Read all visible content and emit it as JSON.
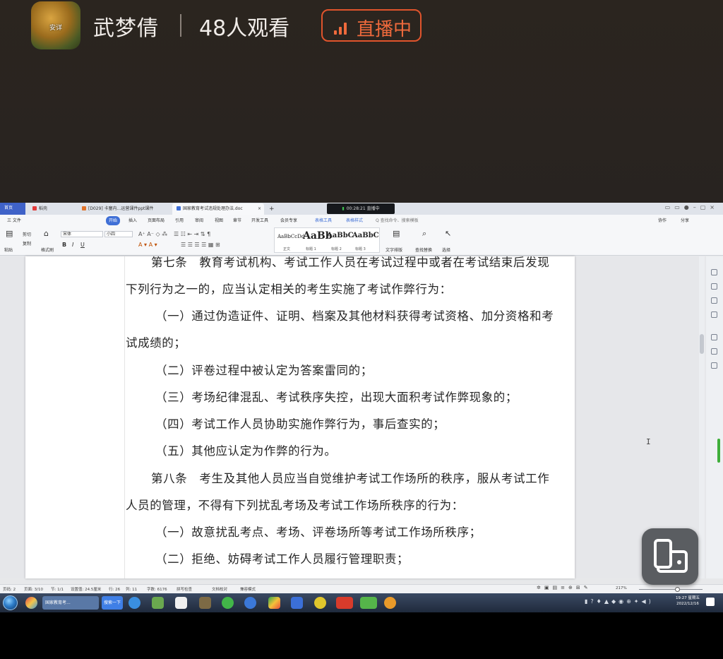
{
  "live": {
    "avatar_tag": "安详",
    "host_name": "武梦倩",
    "separator": "|",
    "viewers": "48人观看",
    "status": "直播中",
    "accent_color": "#ef6a3c"
  },
  "tabbar": {
    "home": "首页",
    "tabs": [
      {
        "label": "稻壳",
        "icon": "wps-docer-icon"
      },
      {
        "label": "[D029] 卡塞内...运营课件ppt课件",
        "icon": "ppt-icon"
      },
      {
        "label": "国家教育考试违规处理办法.doc",
        "icon": "word-doc-icon"
      }
    ],
    "new_tab": "+",
    "close": "×",
    "recording": "00:28:21 直播中"
  },
  "ribbon": {
    "menu": [
      "三 文件",
      "开始",
      "插入",
      "页面布局",
      "引用",
      "审阅",
      "视图",
      "章节",
      "开发工具",
      "会员专享",
      "表格工具",
      "表格样式",
      "Q 查找命令、搜索模板"
    ],
    "right_actions": [
      "协作",
      "分享"
    ],
    "clipboard": [
      "粘贴",
      "剪切",
      "复制",
      "格式刷"
    ],
    "font_name": "宋体",
    "font_size": "小四",
    "styles": [
      {
        "sample": "AaBbCcDd",
        "caption": "正文"
      },
      {
        "sample": "AaBb",
        "caption": "标题 1"
      },
      {
        "sample": "AaBbC",
        "caption": "标题 2"
      },
      {
        "sample": "AaBbC",
        "caption": "标题 3"
      }
    ],
    "tools": [
      "文字排版",
      "查找替换",
      "选择"
    ]
  },
  "document": {
    "lines": [
      "第七条　教育考试机构、考试工作人员在考试过程中或者在考试结束后发现",
      "下列行为之一的，应当认定相关的考生实施了考试作弊行为：",
      "（一）通过伪造证件、证明、档案及其他材料获得考试资格、加分资格和考",
      "试成绩的；",
      "（二）评卷过程中被认定为答案雷同的；",
      "（三）考场纪律混乱、考试秩序失控，出现大面积考试作弊现象的；",
      "（四）考试工作人员协助实施作弊行为，事后查实的；",
      "（五）其他应认定为作弊的行为。",
      "第八条　考生及其他人员应当自觉维护考试工作场所的秩序，服从考试工作",
      "人员的管理，不得有下列扰乱考场及考试工作场所秩序的行为：",
      "（一）故意扰乱考点、考场、评卷场所等考试工作场所秩序；",
      "（二）拒绝、妨碍考试工作人员履行管理职责；"
    ],
    "cursor": "I"
  },
  "statusbar": {
    "items": [
      "页码: 2",
      "页面: 3/10",
      "节: 1/1",
      "设置值: 24.5厘米",
      "行: 26",
      "列: 11",
      "字数: 6176",
      "拼写检查",
      "文档校对",
      "兼容模式"
    ],
    "zoom": "217%"
  },
  "taskbar": {
    "window_button": "国家教育考...",
    "search_button": "搜索一下",
    "clock_time": "19:27 星期五",
    "clock_date": "2022/12/16"
  }
}
